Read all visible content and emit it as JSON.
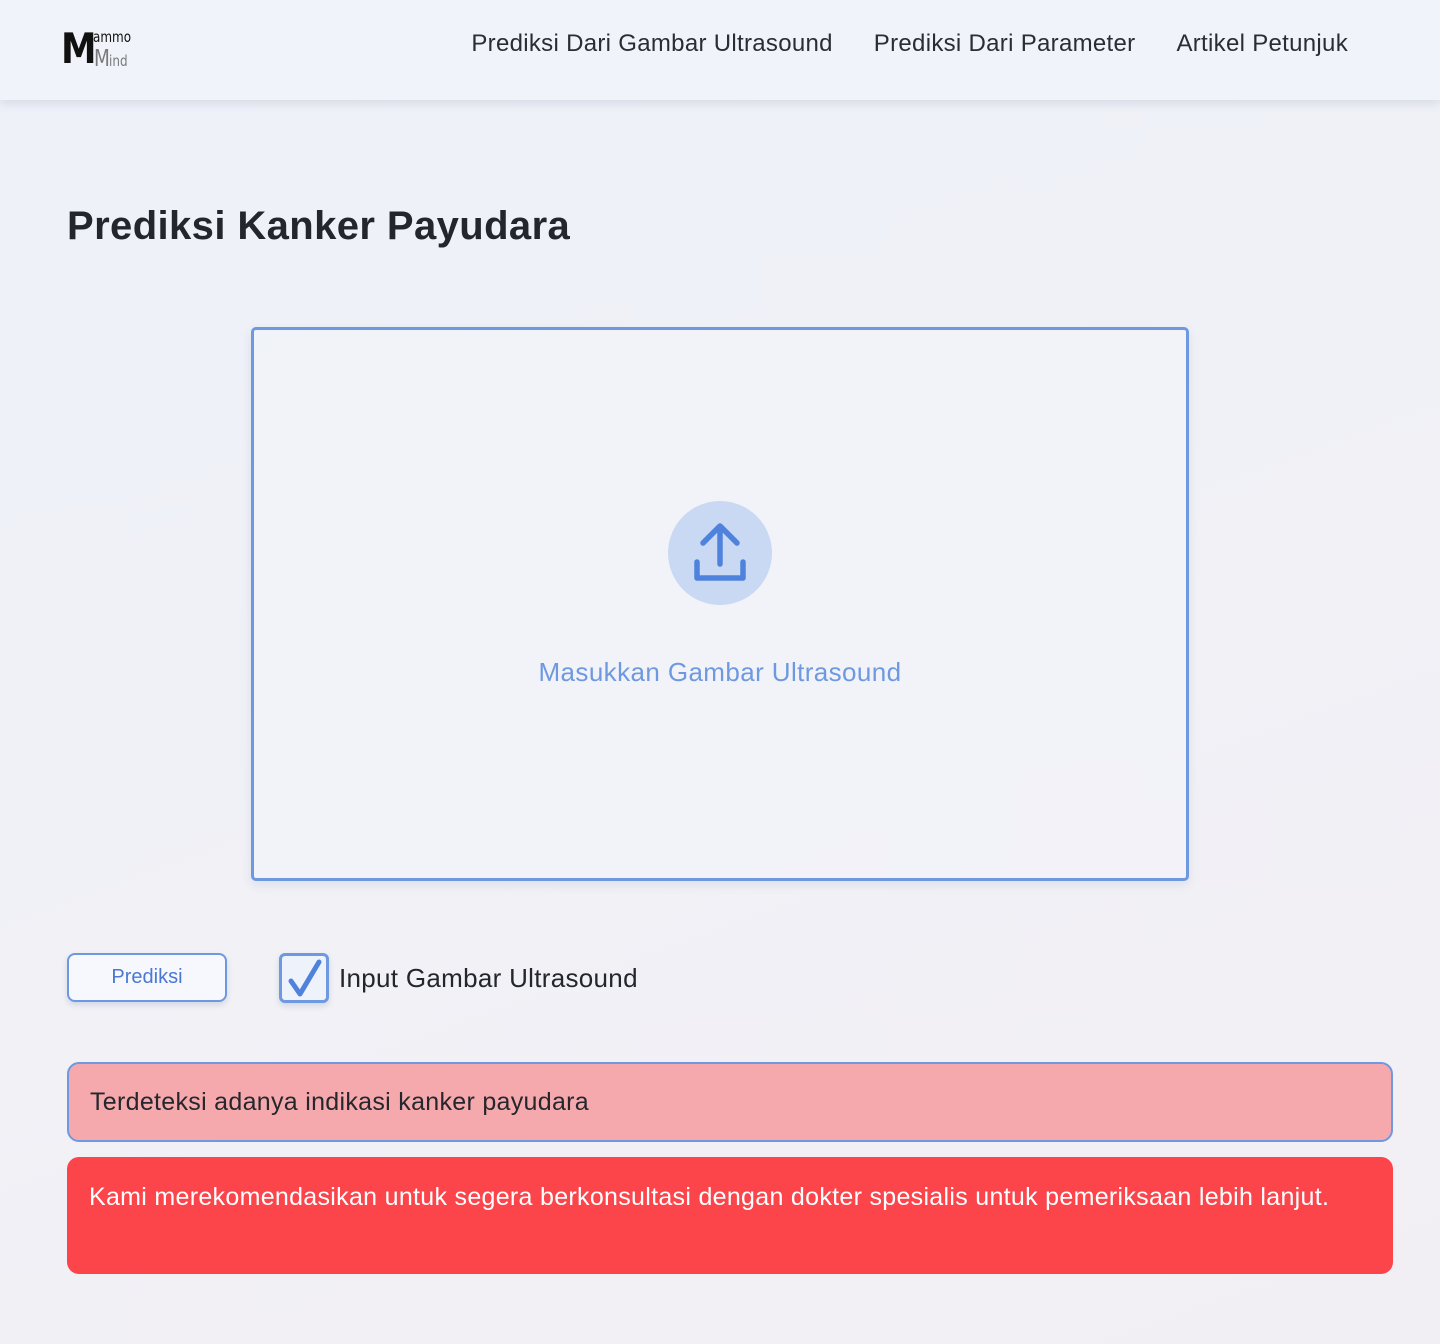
{
  "header": {
    "logo": {
      "big_letter": "M",
      "top_text": "ammo",
      "small_letter": "M",
      "bottom_text": "ind"
    },
    "nav": [
      {
        "label": "Prediksi Dari Gambar Ultrasound"
      },
      {
        "label": "Prediksi Dari Parameter"
      },
      {
        "label": "Artikel Petunjuk"
      }
    ]
  },
  "main": {
    "title": "Prediksi Kanker Payudara",
    "upload": {
      "icon": "upload-icon",
      "label": "Masukkan Gambar Ultrasound"
    },
    "predict_button": "Prediksi",
    "checkbox": {
      "checked": true,
      "label": "Input Gambar Ultrasound"
    },
    "result": {
      "text": "Terdeteksi adanya indikasi kanker payudara"
    },
    "recommendation": {
      "text": "Kami merekomendasikan untuk segera berkonsultasi dengan dokter spesialis untuk pemeriksaan lebih lanjut."
    }
  },
  "colors": {
    "accent": "#6e99e0",
    "upload_circle": "#c9d8f3",
    "result_bg": "#f5a9ad",
    "recommendation_bg": "#fb454b",
    "text_dark": "#23262d"
  }
}
